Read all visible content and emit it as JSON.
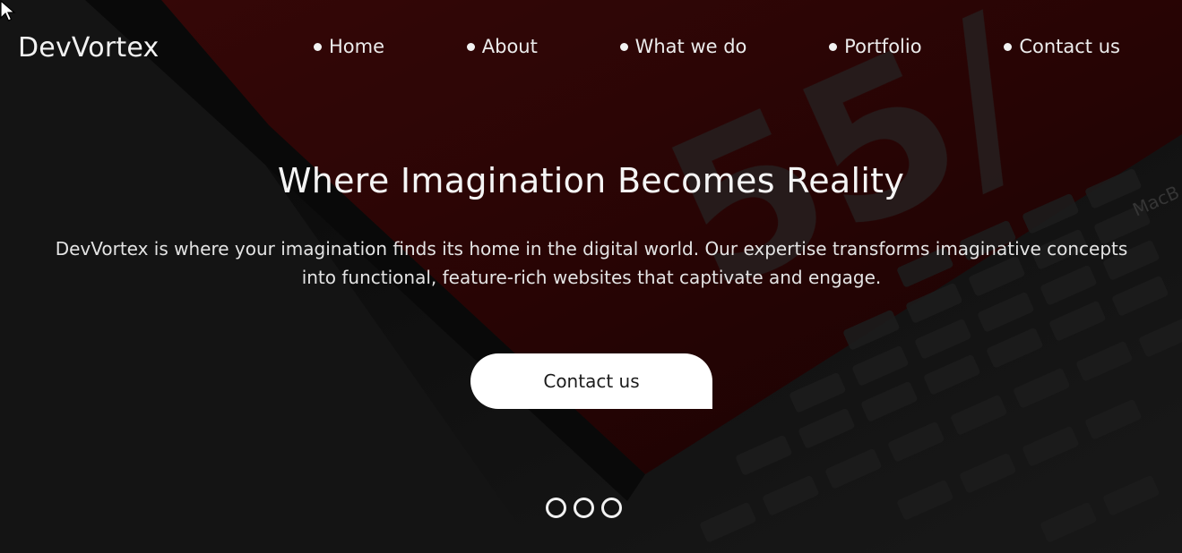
{
  "brand": {
    "name": "DevVortex"
  },
  "nav": {
    "items": [
      {
        "label": "Home"
      },
      {
        "label": "About"
      },
      {
        "label": "What we do"
      },
      {
        "label": "Portfolio"
      },
      {
        "label": "Contact us"
      }
    ]
  },
  "hero": {
    "title": "Where Imagination Becomes Reality",
    "description": "DevVortex is where your imagination finds its home in the digital world. Our expertise transforms imaginative concepts into functional, feature-rich websites that captivate and engage.",
    "cta_label": "Contact us"
  },
  "carousel": {
    "dot_count": 3
  },
  "background": {
    "screen_text": "55/",
    "keyboard_brand": "MacB"
  },
  "colors": {
    "background": "#151515",
    "accent_red": "#3a0606",
    "text": "#f2f2f2",
    "button_bg": "#ffffff",
    "button_text": "#1c1c1c"
  }
}
